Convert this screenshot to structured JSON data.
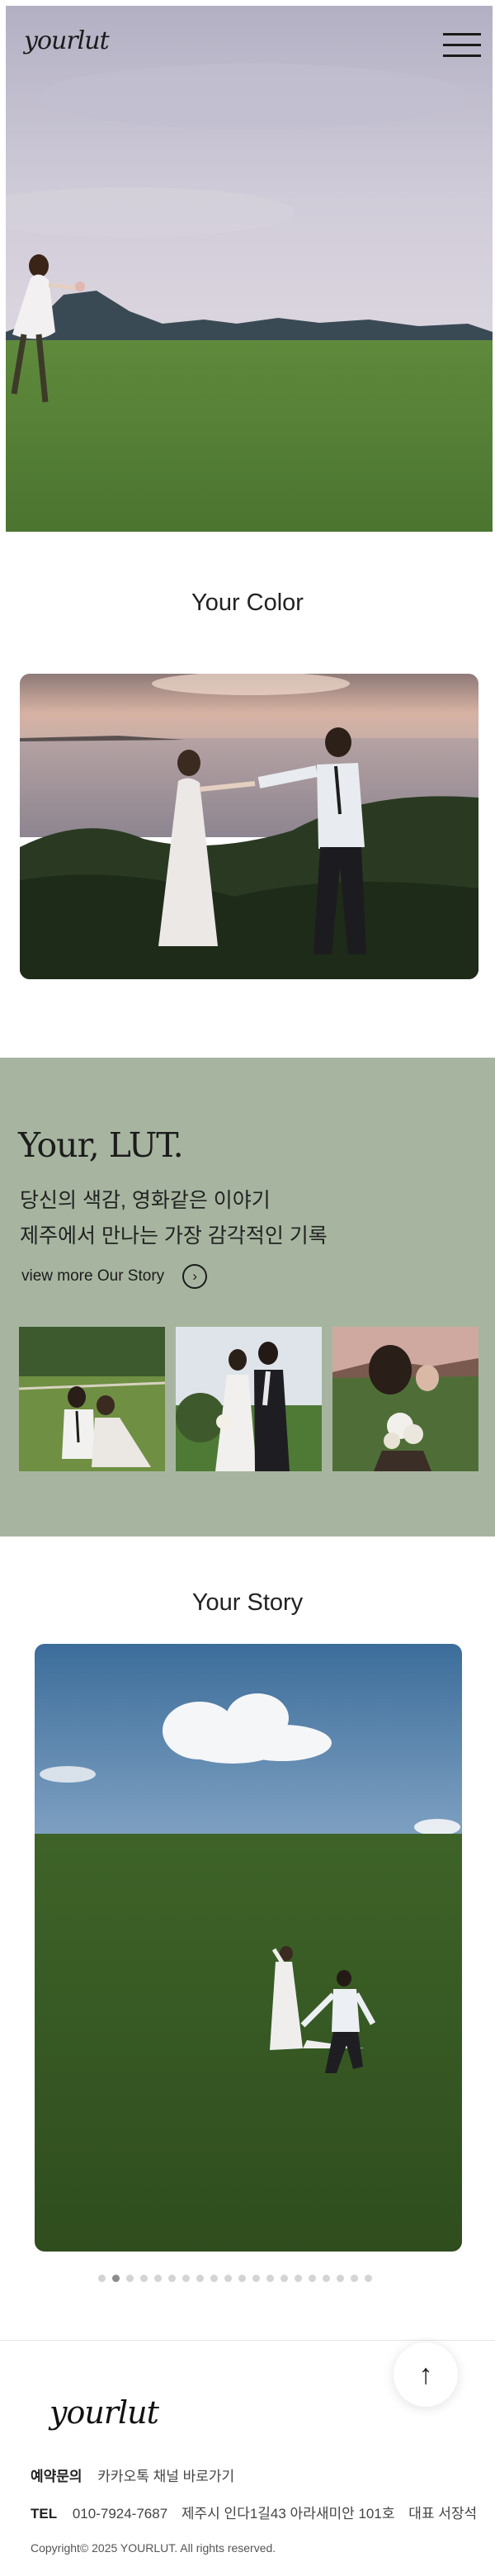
{
  "header": {
    "logo": "yourlut",
    "menu_icon": "hamburger-menu-icon"
  },
  "sections": {
    "color_title": "Your Color",
    "story_title": "Your Story"
  },
  "lut": {
    "title": "Your, LUT.",
    "line1": "당신의 색감, 영화같은 이야기",
    "line2": "제주에서 만나는 가장 감각적인 기록",
    "more_label": "view more Our Story",
    "more_icon": "chevron-right-circle-icon"
  },
  "slider": {
    "total": 20,
    "active": 1
  },
  "footer": {
    "logo": "yourlut",
    "reservation_label": "예약문의",
    "reservation_link": "카카오톡 채널 바로가기",
    "tel_label": "TEL",
    "tel": "010-7924-7687",
    "address": "제주시 인다1길43 아라새미안 101호",
    "ceo": "대표 서장석",
    "copyright": "Copyright© 2025 YOURLUT. All rights reserved.",
    "top_icon": "↑"
  },
  "colors": {
    "lut_bg": "#a7b5a0",
    "text": "#222222"
  }
}
